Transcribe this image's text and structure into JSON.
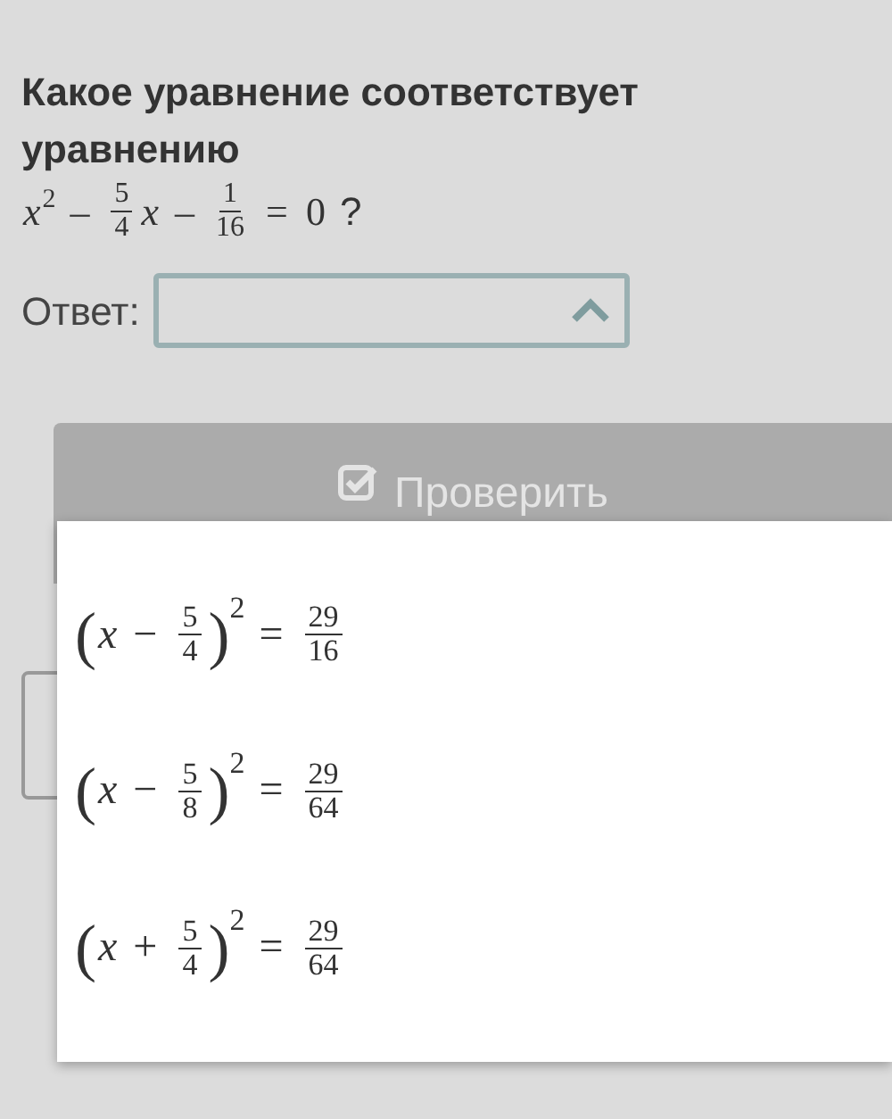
{
  "question": {
    "text": "Какое уравнение соответствует уравнению",
    "math": [
      {
        "kind": "var",
        "text": "x"
      },
      {
        "kind": "sup",
        "text": "2"
      },
      {
        "kind": "op",
        "text": "–"
      },
      {
        "kind": "frac",
        "num": "5",
        "den": "4"
      },
      {
        "kind": "var",
        "text": "x"
      },
      {
        "kind": "op",
        "text": "–"
      },
      {
        "kind": "frac",
        "num": "1",
        "den": "16"
      },
      {
        "kind": "op",
        "text": "="
      },
      {
        "kind": "num",
        "text": "0"
      },
      {
        "kind": "plain",
        "text": "?"
      }
    ]
  },
  "answer": {
    "label": "Ответ:",
    "expanded": true
  },
  "check_button": {
    "label": "Проверить"
  },
  "options": [
    {
      "math": [
        {
          "kind": "paren",
          "text": "("
        },
        {
          "kind": "var",
          "text": "x"
        },
        {
          "kind": "op",
          "text": "−"
        },
        {
          "kind": "frac",
          "num": "5",
          "den": "4"
        },
        {
          "kind": "paren",
          "text": ")"
        },
        {
          "kind": "sup",
          "text": "2"
        },
        {
          "kind": "op",
          "text": "="
        },
        {
          "kind": "frac",
          "num": "29",
          "den": "16"
        }
      ]
    },
    {
      "math": [
        {
          "kind": "paren",
          "text": "("
        },
        {
          "kind": "var",
          "text": "x"
        },
        {
          "kind": "op",
          "text": "−"
        },
        {
          "kind": "frac",
          "num": "5",
          "den": "8"
        },
        {
          "kind": "paren",
          "text": ")"
        },
        {
          "kind": "sup",
          "text": "2"
        },
        {
          "kind": "op",
          "text": "="
        },
        {
          "kind": "frac",
          "num": "29",
          "den": "64"
        }
      ]
    },
    {
      "math": [
        {
          "kind": "paren",
          "text": "("
        },
        {
          "kind": "var",
          "text": "x"
        },
        {
          "kind": "op",
          "text": "+"
        },
        {
          "kind": "frac",
          "num": "5",
          "den": "4"
        },
        {
          "kind": "paren",
          "text": ")"
        },
        {
          "kind": "sup",
          "text": "2"
        },
        {
          "kind": "op",
          "text": "="
        },
        {
          "kind": "frac",
          "num": "29",
          "den": "64"
        }
      ]
    }
  ]
}
